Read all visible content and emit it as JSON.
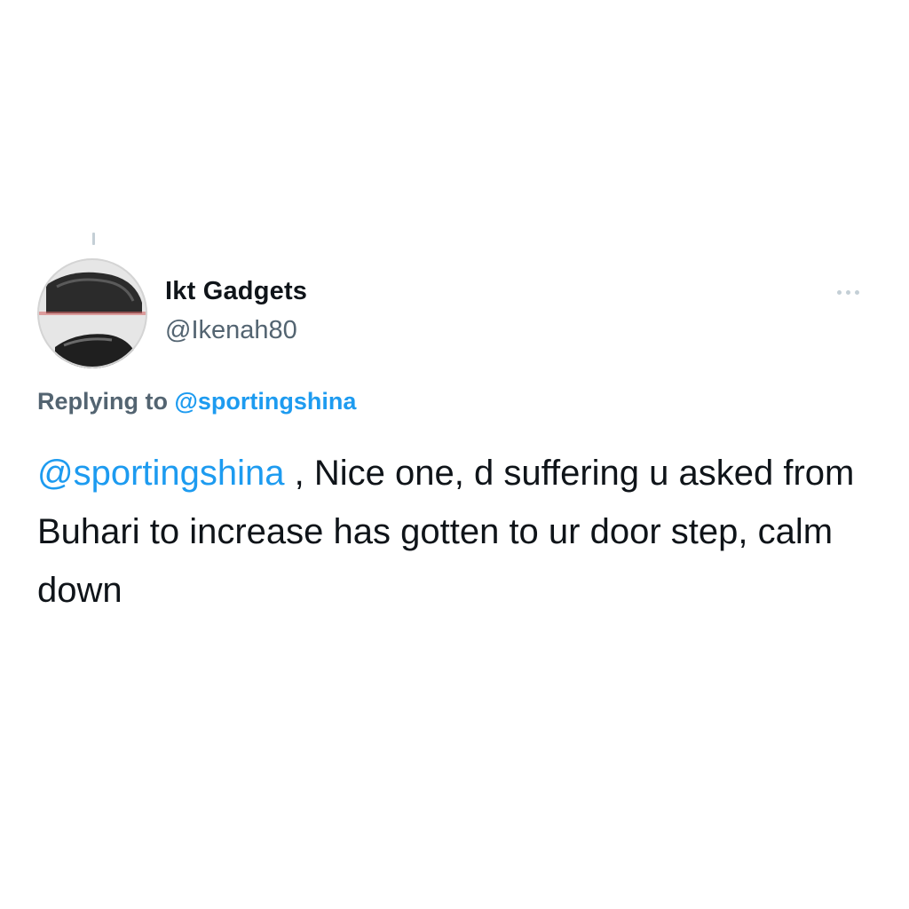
{
  "tweet": {
    "author": {
      "display_name": "Ikt Gadgets",
      "handle": "@Ikenah80",
      "avatar_icon": "avatar-photo"
    },
    "more_icon": "more-dots-icon",
    "reply_context": {
      "prefix": "Replying to",
      "handle": "@sportingshina"
    },
    "body": {
      "mention": "@sportingshina",
      "text": " , Nice one, d suffering u asked from Buhari to increase has gotten to ur door step, calm down"
    }
  },
  "colors": {
    "link": "#1d9bf0",
    "secondary": "#536471",
    "text": "#0f1419",
    "background": "#ffffff"
  }
}
